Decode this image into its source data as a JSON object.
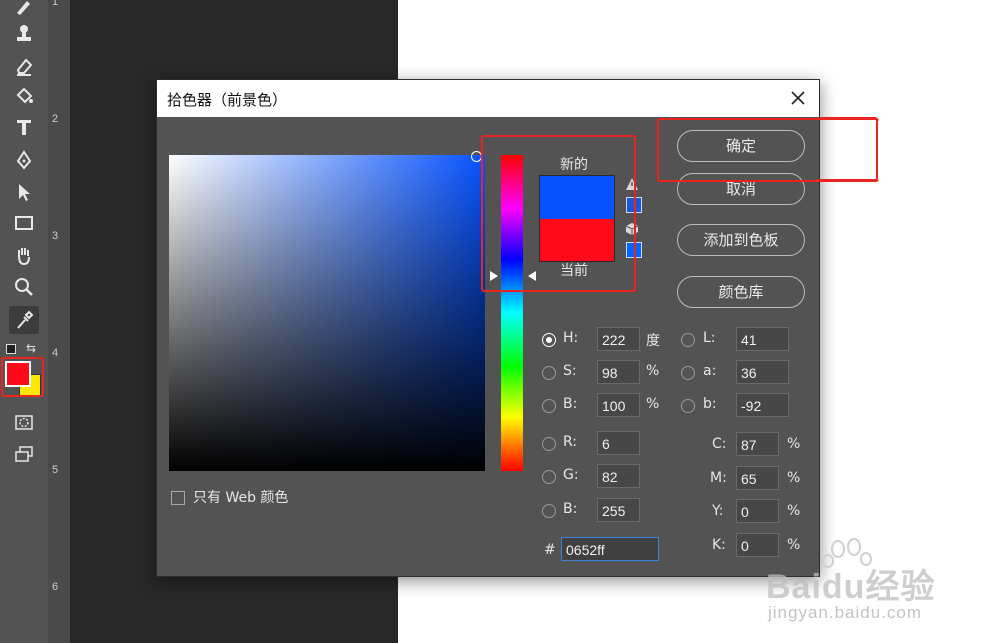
{
  "ruler": {
    "ticks": [
      "1",
      "2",
      "3",
      "4",
      "5",
      "6"
    ]
  },
  "toolbar": {
    "tools": [
      "brush-icon",
      "stamp-icon",
      "eraser-icon",
      "paint-bucket-icon",
      "type-icon",
      "pen-icon",
      "selection-arrow-icon",
      "rectangle-icon",
      "hand-icon",
      "zoom-icon",
      "eyedropper-icon"
    ],
    "foreground_color": "#ff0a1a",
    "background_color": "#ffe800"
  },
  "dialog": {
    "title": "拾色器（前景色）",
    "new_label": "新的",
    "current_label": "当前",
    "new_color": "#0652ff",
    "current_color": "#ff0a1a",
    "buttons": {
      "ok": "确定",
      "cancel": "取消",
      "add_to_swatches": "添加到色板",
      "color_libraries": "颜色库"
    },
    "web_only": "只有 Web 颜色",
    "hsb": {
      "h_label": "H:",
      "h_value": "222",
      "h_unit": "度",
      "s_label": "S:",
      "s_value": "98",
      "s_unit": "%",
      "b_label": "B:",
      "b_value": "100",
      "b_unit": "%"
    },
    "rgb": {
      "r_label": "R:",
      "r_value": "6",
      "g_label": "G:",
      "g_value": "82",
      "b_label": "B:",
      "b_value": "255"
    },
    "lab": {
      "l_label": "L:",
      "l_value": "41",
      "a_label": "a:",
      "a_value": "36",
      "b_label": "b:",
      "b_value": "-92"
    },
    "cmyk": {
      "c_label": "C:",
      "c_value": "87",
      "c_unit": "%",
      "m_label": "M:",
      "m_value": "65",
      "m_unit": "%",
      "y_label": "Y:",
      "y_value": "0",
      "y_unit": "%",
      "k_label": "K:",
      "k_value": "0",
      "k_unit": "%"
    },
    "hex": {
      "label": "#",
      "value": "0652ff"
    }
  },
  "watermark": {
    "brand": "Baidu经验",
    "url": "jingyan.baidu.com"
  },
  "annotation_color": "#e8251f"
}
